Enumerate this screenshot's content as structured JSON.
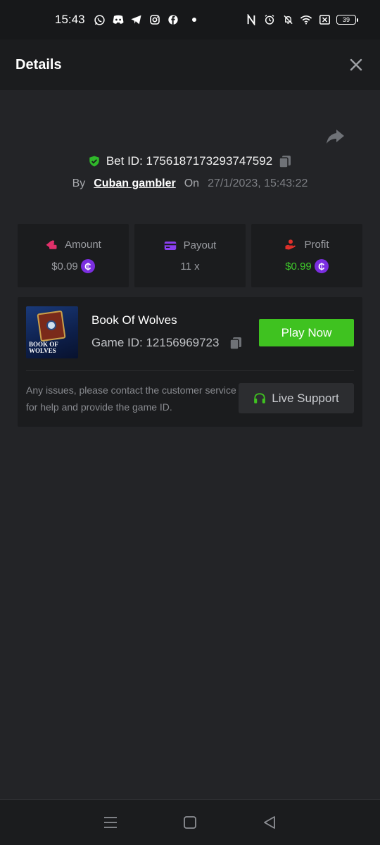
{
  "status_bar": {
    "time": "15:43",
    "battery": "39",
    "notification_icons": [
      "whatsapp-icon",
      "discord-icon",
      "telegram-icon",
      "instagram-icon",
      "facebook-icon"
    ],
    "system_icons": [
      "nfc-icon",
      "alarm-icon",
      "mute-icon",
      "wifi-icon",
      "no-sim-icon"
    ]
  },
  "header": {
    "title": "Details"
  },
  "bet": {
    "bet_id_label": "Bet ID: 1756187173293747592",
    "by_label": "By",
    "user": "Cuban gambler",
    "on_label": "On",
    "date": "27/1/2023, 15:43:22"
  },
  "stats": {
    "amount_label": "Amount",
    "amount_value": "$0.09",
    "payout_label": "Payout",
    "payout_value": "11 x",
    "profit_label": "Profit",
    "profit_value": "$0.99",
    "coin_symbol": "₵"
  },
  "game": {
    "name": "Book Of Wolves",
    "id_label": "Game ID: 12156969723",
    "play_label": "Play Now",
    "thumb_text_1": "BOOK OF",
    "thumb_text_2": "WOLVES",
    "issue_text": "Any issues, please contact the customer service for help and provide the game ID.",
    "support_label": "Live Support"
  },
  "colors": {
    "background": "#232427",
    "card": "#1b1c1e",
    "accent_green": "#3fc220",
    "profit_green": "#3fcc2b",
    "coin_purple": "#7b2ee0",
    "amount_icon": "#e0306a",
    "payout_icon": "#8a3ff0",
    "profit_icon": "#e0302a"
  }
}
